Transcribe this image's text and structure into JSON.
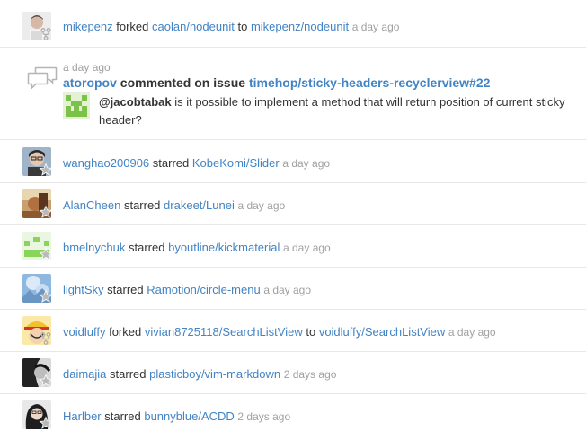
{
  "feed": {
    "item1": {
      "actor": "mikepenz",
      "verb": "forked",
      "repo": "caolan/nodeunit",
      "to": "to",
      "target": "mikepenz/nodeunit",
      "time": "a day ago"
    },
    "comment": {
      "time": "a day ago",
      "actor": "atoropov",
      "verb": "commented on issue",
      "target": "timehop/sticky-headers-recyclerview#22",
      "mention": "@jacobtabak",
      "body_line1": " is it possible to implement a method that will return position of current sticky",
      "body_line2": "header?",
      "icon": "comment-icon"
    },
    "item3": {
      "actor": "wanghao200906",
      "verb": "starred",
      "repo": "KobeKomi/Slider",
      "time": "a day ago"
    },
    "item4": {
      "actor": "AlanCheen",
      "verb": "starred",
      "repo": "drakeet/Lunei",
      "time": "a day ago"
    },
    "item5": {
      "actor": "bmelnychuk",
      "verb": "starred",
      "repo": "byoutline/kickmaterial",
      "time": "a day ago"
    },
    "item6": {
      "actor": "lightSky",
      "verb": "starred",
      "repo": "Ramotion/circle-menu",
      "time": "a day ago"
    },
    "item7": {
      "actor": "voidluffy",
      "verb": "forked",
      "repo": "vivian8725118/SearchListView",
      "to": "to",
      "target": "voidluffy/SearchListView",
      "time": "a day ago"
    },
    "item8": {
      "actor": "daimajia",
      "verb": "starred",
      "repo": "plasticboy/vim-markdown",
      "time": "2 days ago"
    },
    "item9": {
      "actor": "Harlber",
      "verb": "starred",
      "repo": "bunnyblue/ACDD",
      "time": "2 days ago"
    }
  },
  "colors": {
    "link": "#4183c4",
    "muted": "#a0a0a0",
    "text": "#333333",
    "divider": "#e8e8e8"
  }
}
